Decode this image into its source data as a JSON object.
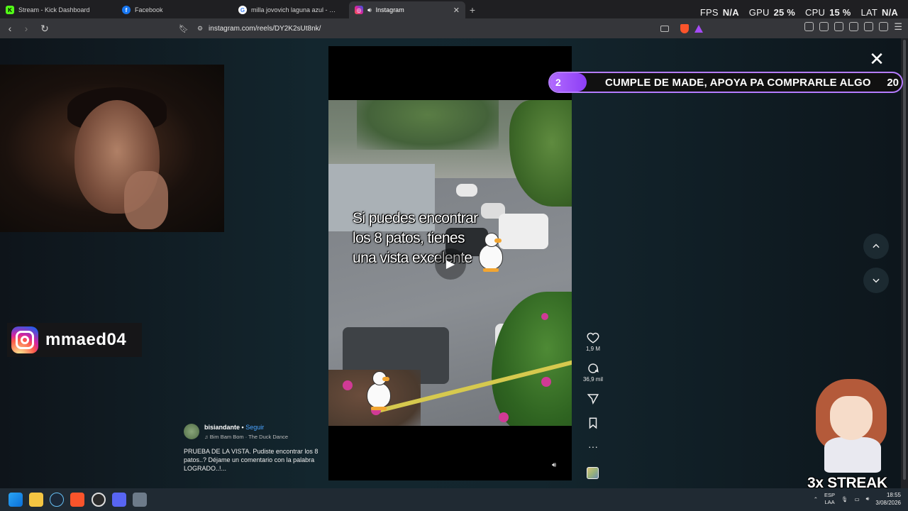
{
  "browser": {
    "tabs": [
      {
        "label": "Stream - Kick Dashboard",
        "favicon": "kick-icon",
        "color": "#53fc18",
        "active": false
      },
      {
        "label": "Facebook",
        "favicon": "facebook-icon",
        "color": "#1877f2",
        "active": false
      },
      {
        "label": "milla jovovich laguna azul - Mask'ana",
        "favicon": "google-icon",
        "color": "#ffffff",
        "active": false
      },
      {
        "label": "Instagram",
        "favicon": "instagram-icon",
        "color": "#d6249f",
        "active": true
      }
    ],
    "url": "instagram.com/reels/DY2K2sUt8nk/"
  },
  "stats": {
    "fps_label": "FPS",
    "fps_value": "N/A",
    "gpu_label": "GPU",
    "gpu_value": "25 %",
    "cpu_label": "CPU",
    "cpu_value": "15 %",
    "lat_label": "LAT",
    "lat_value": "N/A"
  },
  "overlay": {
    "instagram_handle": "mmaed04",
    "banner_count": "2",
    "banner_text": "CUMPLE DE MADE, APOYA PA COMPRARLE ALGO",
    "banner_goal": "20",
    "streak_text": "3x STREAK"
  },
  "reel": {
    "video_text": "Si puedes encontrar los 8 patos, tienes una vista excelente",
    "likes": "1,9 M",
    "comments": "36,9 mil",
    "author": "bisiandante",
    "follow_label": "Seguir",
    "audio": "Bim Bam Bom · The Duck Dance",
    "caption": "PRUEBA DE LA VISTA. Pudiste encontrar los 8 patos..? Déjame un comentario con la palabra LOGRADO..!..."
  },
  "taskbar": {
    "lang_top": "ESP",
    "lang_bottom": "LAA",
    "time": "18:55",
    "date": "3/08/2026"
  }
}
